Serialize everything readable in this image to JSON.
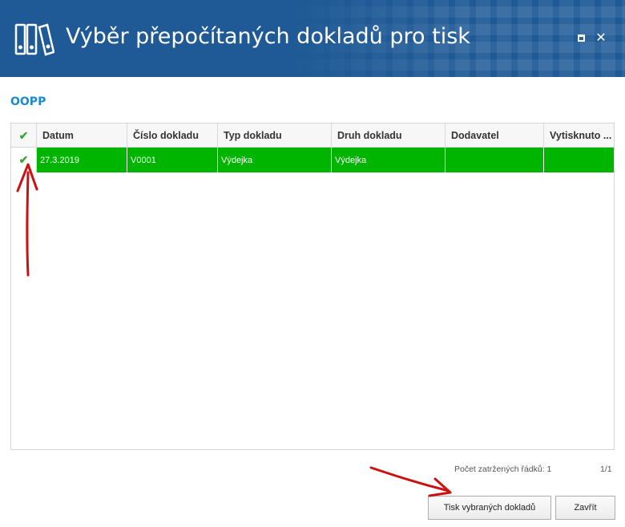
{
  "window": {
    "title": "Výběr přepočítaných dokladů pro tisk",
    "icon": "binders-icon",
    "controls": [
      "maximize-icon",
      "close-icon"
    ]
  },
  "section": {
    "title": "OOPP"
  },
  "grid": {
    "columns": [
      "Datum",
      "Číslo dokladu",
      "Typ dokladu",
      "Druh dokladu",
      "Dodavatel",
      "Vytisknuto ..."
    ],
    "rows": [
      {
        "checked": true,
        "cells": [
          "27.3.2019",
          "V0001",
          "Výdejka",
          "Výdejka",
          "",
          ""
        ]
      }
    ],
    "selected_row_color": "#00b500"
  },
  "status": {
    "count_label": "Počet zatržených řádků: 1",
    "page": "1/1"
  },
  "buttons": {
    "print": "Tisk vybraných dokladů",
    "close": "Zavřít"
  },
  "annotation_color": "#cc0000"
}
